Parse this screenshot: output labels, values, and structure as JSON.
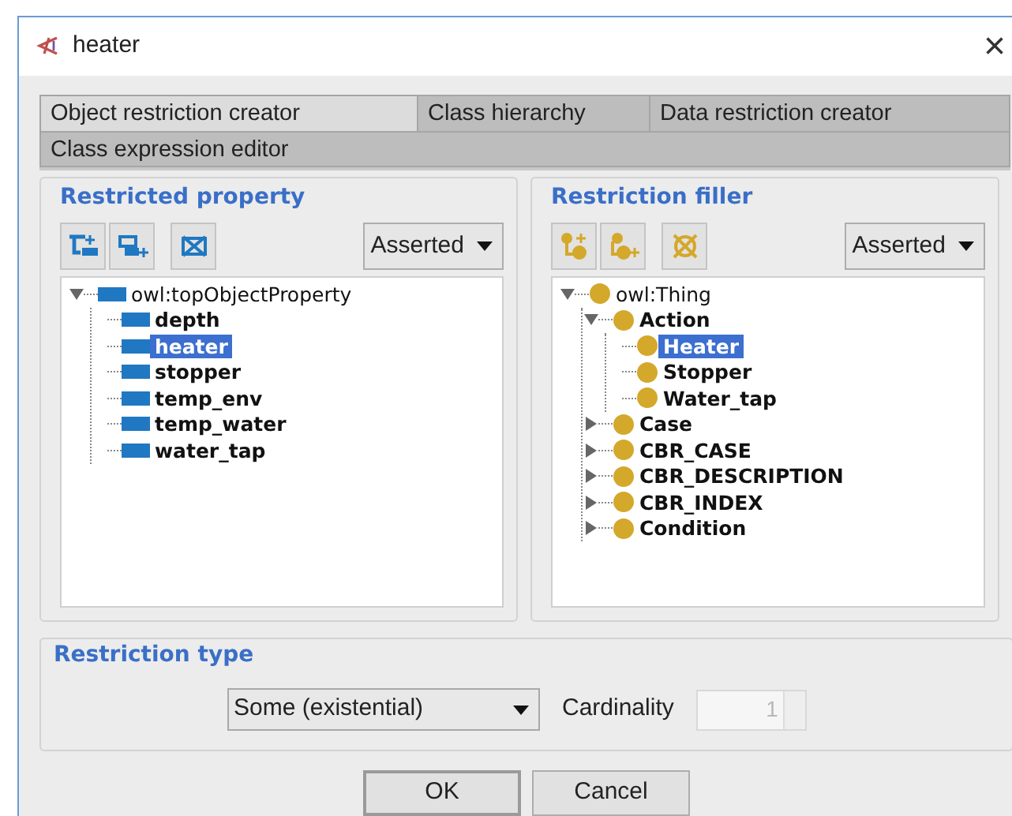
{
  "window": {
    "title": "heater",
    "close": "×"
  },
  "tabs": [
    [
      {
        "label": "Object restriction creator",
        "selected": true
      },
      {
        "label": "Class hierarchy",
        "selected": false
      },
      {
        "label": "Data restriction creator",
        "selected": false
      }
    ],
    [
      {
        "label": "Class expression editor",
        "selected": false
      }
    ]
  ],
  "panels": [
    {
      "kind": "property",
      "title": "Restricted property",
      "mode": "Asserted",
      "tree": [
        {
          "label": "owl:topObjectProperty",
          "bold": false,
          "selected": false,
          "expanded": true,
          "children": [
            {
              "label": "depth",
              "bold": true,
              "selected": false
            },
            {
              "label": "heater",
              "bold": true,
              "selected": true
            },
            {
              "label": "stopper",
              "bold": true,
              "selected": false
            },
            {
              "label": "temp_env",
              "bold": true,
              "selected": false
            },
            {
              "label": "temp_water",
              "bold": true,
              "selected": false
            },
            {
              "label": "water_tap",
              "bold": true,
              "selected": false
            }
          ]
        }
      ]
    },
    {
      "kind": "class",
      "title": "Restriction filler",
      "mode": "Asserted",
      "tree": [
        {
          "label": "owl:Thing",
          "bold": false,
          "selected": false,
          "expanded": true,
          "children": [
            {
              "label": "Action",
              "bold": true,
              "selected": false,
              "expanded": true,
              "children": [
                {
                  "label": "Heater",
                  "bold": true,
                  "selected": true
                },
                {
                  "label": "Stopper",
                  "bold": true,
                  "selected": false
                },
                {
                  "label": "Water_tap",
                  "bold": true,
                  "selected": false
                }
              ]
            },
            {
              "label": "Case",
              "bold": true,
              "selected": false,
              "expanded": false
            },
            {
              "label": "CBR_CASE",
              "bold": true,
              "selected": false,
              "expanded": false
            },
            {
              "label": "CBR_DESCRIPTION",
              "bold": true,
              "selected": false,
              "expanded": false
            },
            {
              "label": "CBR_INDEX",
              "bold": true,
              "selected": false,
              "expanded": false
            },
            {
              "label": "Condition",
              "bold": true,
              "selected": false,
              "expanded": false
            }
          ]
        }
      ]
    }
  ],
  "restriction_type": {
    "title": "Restriction type",
    "value": "Some (existential)",
    "cardinality_label": "Cardinality",
    "cardinality": "1",
    "cardinality_disabled": true
  },
  "buttons": [
    "OK",
    "Cancel"
  ]
}
